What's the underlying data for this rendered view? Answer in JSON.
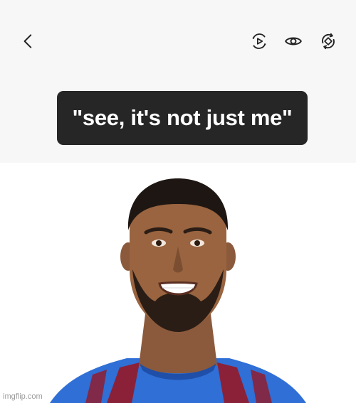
{
  "toolbar": {
    "back_icon": "chevron-left-icon",
    "play_icon": "play-circle-icon",
    "eye_icon": "eye-icon",
    "rotate_icon": "rotate-icon"
  },
  "caption": {
    "text": "\"see, it's not just me\""
  },
  "photo": {
    "watermark": "imgflip.com"
  },
  "colors": {
    "panel_bg": "#f7f7f7",
    "bubble_bg": "#262626",
    "caption_text": "#ffffff",
    "jersey_blue": "#2f6fd6",
    "jersey_maroon": "#8a2138"
  }
}
